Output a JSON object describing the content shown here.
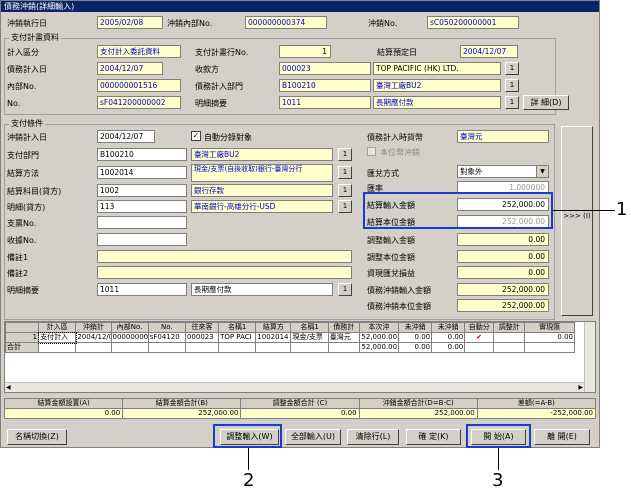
{
  "window": {
    "title": "債務沖銷(詳細輸入)"
  },
  "header": {
    "offset_date_label": "沖銷執行日",
    "offset_date": "2005/02/08",
    "internal_no_label": "沖銷內部No.",
    "internal_no": "000000000374",
    "offset_no_label": "沖銷No.",
    "offset_no": "sC050200000001"
  },
  "plan": {
    "group_label": "支付計畫資料",
    "calc_div_label": "計入區分",
    "calc_div": "支付計入委託資料",
    "payment_plan_no_label": "支付計畫行No.",
    "payment_plan_no": "1",
    "settle_date_label": "結算預定日",
    "settle_date": "2004/12/07",
    "debt_date_label": "債務計入日",
    "debt_date": "2004/12/07",
    "payee_label": "收款方",
    "payee_code": "000023",
    "payee_name": "TOP PACIFIC (HK) LTD.",
    "internal_no_label": "內部No.",
    "internal_no": "000000001516",
    "debt_dept_label": "債務計入部門",
    "debt_dept_code": "B100210",
    "debt_dept_name": "臺灣工廠BU2",
    "no_label": "No.",
    "no": "sF041200000002",
    "detail_summary_label": "明細摘要",
    "detail_summary_code": "1011",
    "detail_summary_name": "長期應付款",
    "detail_button": "詳 細(D)"
  },
  "conditions": {
    "group_label": "支付條件",
    "offset_date_label": "沖銷計入日",
    "offset_date": "2004/12/07",
    "auto_split_label": "自動分錄對象",
    "debt_currency_label": "債務計入時貨幣",
    "debt_currency": "臺灣元",
    "pay_dept_label": "支付部門",
    "pay_dept_code": "B100210",
    "pay_dept_name": "臺灣工廠BU2",
    "local_offset_label": "本位幣沖銷",
    "settle_method_label": "結算方法",
    "settle_method_code": "1002014",
    "settle_method_name": "現金/支票(自後收取)銀行-臺灣分行",
    "exchange_method_label": "匯兌方式",
    "exchange_method": "對象外",
    "settle_subject_label": "結算科目(貸方)",
    "settle_subject_code": "1002",
    "settle_subject_name": "銀行存款",
    "rate_label": "匯率",
    "rate": "1.000000",
    "detail_credit_label": "明細(貸方)",
    "detail_credit_code": "113",
    "detail_credit_name": "華南銀行-高雄分行-USD",
    "settle_input_label": "結算輸入金額",
    "settle_input": "252,000.00",
    "check_no_label": "支票No.",
    "settle_local_label": "結算本位金額",
    "settle_local": "252,000.00",
    "receipt_no_label": "收據No.",
    "adj_input_label": "調整輸入金額",
    "adj_input": "0.00",
    "remark1_label": "備註1",
    "adj_local_label": "調整本位金額",
    "adj_local": "0.00",
    "remark2_label": "備註2",
    "fx_loss_label": "資現匯兌損益",
    "fx_loss": "0.00",
    "detail_summary_label": "明細摘要",
    "detail_summary_code": "1011",
    "detail_summary_name": "長期應付款",
    "debt_offset_input_label": "債務沖銷輸入金額",
    "debt_offset_input": "252,000.00",
    "debt_offset_local_label": "債務沖銷本位金額",
    "debt_offset_local": "252,000.00",
    "side_button": ">>> (I)"
  },
  "grid": {
    "headers": [
      "",
      "計入區",
      "沖銷計",
      "內部No.",
      "No.",
      "往來客",
      "名稱1",
      "結算方",
      "名稱1",
      "債務計",
      "本次沖",
      "未沖銷",
      "未沖銷",
      "自動分",
      "調整計",
      "實現匯"
    ],
    "rows": [
      [
        "1",
        "支付計入",
        "2004/12/0",
        "00000000",
        "sF04120",
        "000023",
        "TOP PACI",
        "1002014",
        "現金/支票",
        "臺灣元",
        "52,000.00",
        "0.00",
        "0.00",
        "✔",
        "",
        "0.00"
      ]
    ],
    "total_label": "合計",
    "total_values": [
      "52,000.00",
      "0.00",
      "0.00"
    ]
  },
  "summary": {
    "headers": [
      "結算金額設置(A)",
      "結算金額合計(B)",
      "調整金額合計 (C)",
      "沖銷金額合計(D=B-C)",
      "差額(=A-B)"
    ],
    "values": [
      "0.00",
      "252,000.00",
      "0.00",
      "252,000.00",
      "-252,000.00"
    ]
  },
  "buttons": {
    "name_switch": "名稱切換(Z)",
    "adjust_input": "調整輸入(W)",
    "all_input": "全部輸入(U)",
    "clear_row": "清除行(L)",
    "confirm": "確 定(K)",
    "start": "開 始(A)",
    "close": "離 開(E)"
  },
  "callouts": {
    "c1": "1",
    "c2": "2",
    "c3": "3"
  }
}
